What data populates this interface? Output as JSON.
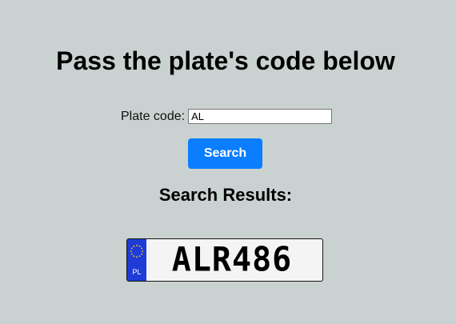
{
  "header": {
    "title": "Pass the plate's code below"
  },
  "form": {
    "label": "Plate code:",
    "input_value": "AL",
    "search_label": "Search"
  },
  "results": {
    "heading": "Search Results:",
    "plates": [
      {
        "country": "PL",
        "number": "ALR486",
        "eu_band_color": "#1f3bd6"
      }
    ]
  },
  "colors": {
    "background": "#c9d2d1",
    "button": "#0a7eff"
  }
}
